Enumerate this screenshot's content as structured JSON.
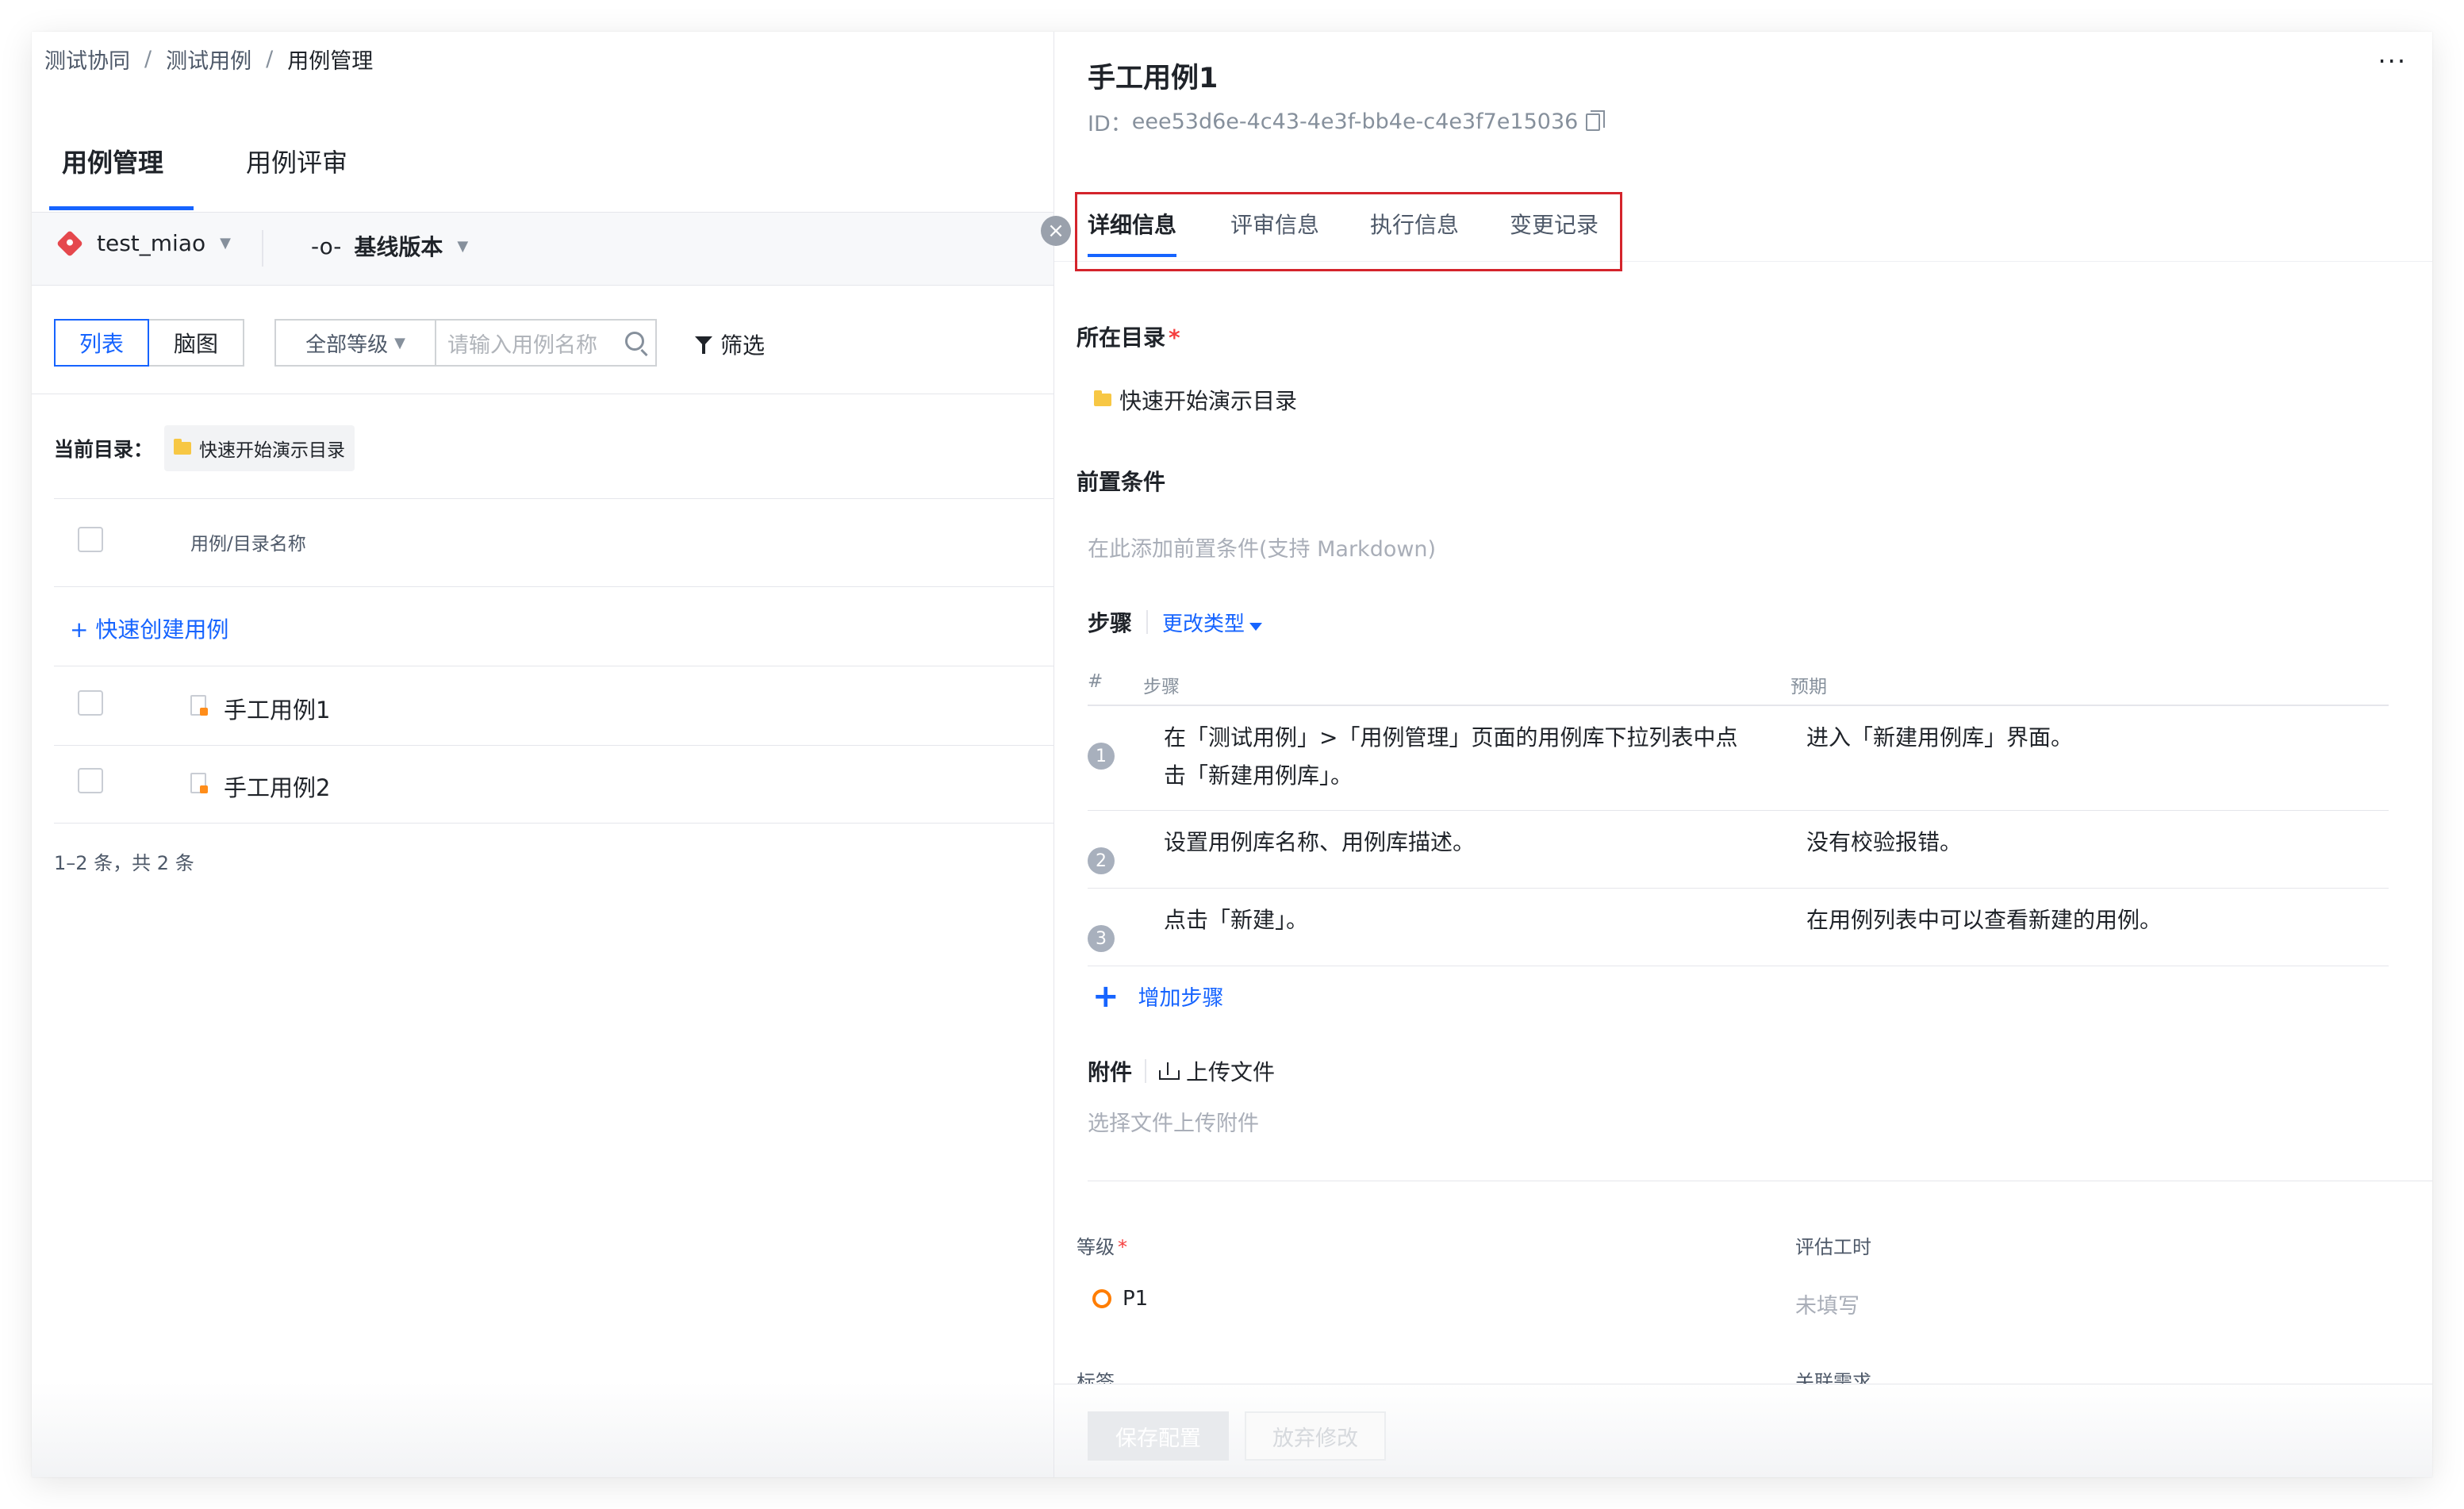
{
  "breadcrumb": [
    "测试协同",
    "测试用例",
    "用例管理"
  ],
  "breadcrumb_sep": "/",
  "left_tabs": [
    "用例管理",
    "用例评审"
  ],
  "repo": {
    "name": "test_miao",
    "baseline": "基线版本"
  },
  "view_toggle": [
    "列表",
    "脑图"
  ],
  "level_filter": "全部等级",
  "search_placeholder": "请输入用例名称",
  "filter_label": "筛选",
  "current_dir": {
    "label": "当前目录：",
    "value": "快速开始演示目录"
  },
  "list": {
    "column_name": "用例/目录名称",
    "quick_create": "+ 快速创建用例",
    "rows": [
      "手工用例1",
      "手工用例2"
    ],
    "pager": "1–2 条，共 2 条"
  },
  "detail": {
    "title": "手工用例1",
    "id_label": "ID：",
    "id_value": "eee53d6e-4c43-4e3f-bb4e-c4e3f7e15036",
    "more": "···",
    "tabs": [
      "详细信息",
      "评审信息",
      "执行信息",
      "变更记录"
    ],
    "dir_label": "所在目录",
    "dir_value": "快速开始演示目录",
    "precondition_label": "前置条件",
    "precondition_placeholder": "在此添加前置条件(支持 Markdown)",
    "steps_label": "步骤",
    "change_type": "更改类型",
    "table_headers": [
      "#",
      "步骤",
      "预期"
    ],
    "steps": [
      {
        "n": "1",
        "step": "在「测试用例」>「用例管理」页面的用例库下拉列表中点击「新建用例库」。",
        "expected": "进入「新建用例库」界面。"
      },
      {
        "n": "2",
        "step": "设置用例库名称、用例库描述。",
        "expected": "没有校验报错。"
      },
      {
        "n": "3",
        "step": "点击「新建」。",
        "expected": "在用例列表中可以查看新建的用例。"
      }
    ],
    "add_step": "增加步骤",
    "attachment_label": "附件",
    "upload_label": "上传文件",
    "attachment_placeholder": "选择文件上传附件",
    "level_label": "等级",
    "level_value": "P1",
    "estimate_label": "评估工时",
    "estimate_value": "未填写",
    "tags_label": "标签",
    "related_label": "关联需求",
    "save_button": "保存配置",
    "discard_button": "放弃修改"
  },
  "colors": {
    "accent": "#1664ff",
    "highlight_box": "#d4242c",
    "required": "#f53f3f",
    "level_p1": "#ff7d00"
  }
}
